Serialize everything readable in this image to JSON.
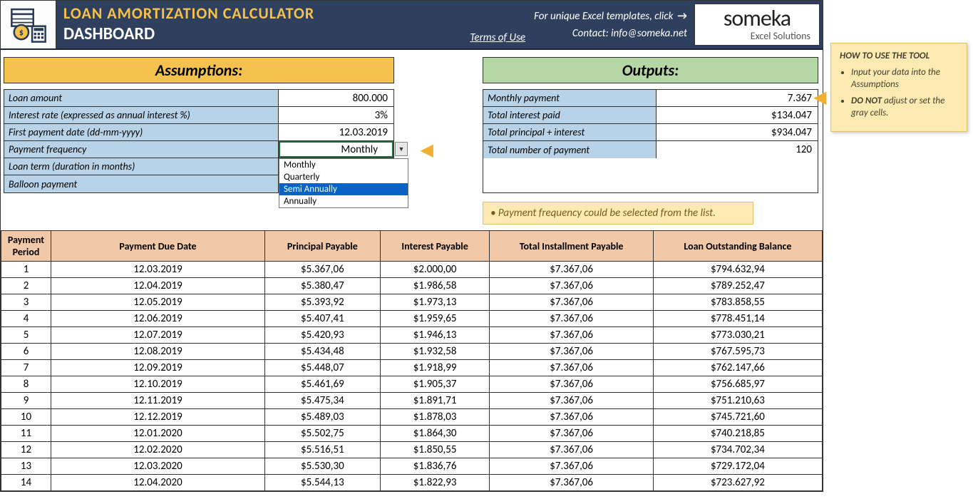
{
  "header": {
    "title": "LOAN AMORTIZATION CALCULATOR",
    "subtitle": "DASHBOARD",
    "terms": "Terms of Use",
    "click_text": "For unique Excel templates, click",
    "contact": "Contact: info@someka.net",
    "logo_big": "someka",
    "logo_small": "Excel Solutions"
  },
  "sections": {
    "assumptions": "Assumptions:",
    "outputs": "Outputs:"
  },
  "assumptions": {
    "rows": [
      {
        "label": "Loan amount",
        "value": "800.000"
      },
      {
        "label": "Interest rate (expressed as annual interest %)",
        "value": "3%"
      },
      {
        "label": "First payment date (dd-mm-yyyy)",
        "value": "12.03.2019"
      },
      {
        "label": "Payment frequency",
        "value": "Monthly"
      },
      {
        "label": "Loan term (duration in months)",
        "value": ""
      },
      {
        "label": "Balloon payment",
        "value": ""
      }
    ],
    "dropdown": {
      "options": [
        "Monthly",
        "Quarterly",
        "Semi Annually",
        "Annually"
      ],
      "selected_index": 2
    }
  },
  "outputs": {
    "rows": [
      {
        "label": "Monthly payment",
        "value": "7.367"
      },
      {
        "label": "Total interest paid",
        "value": "$134.047"
      },
      {
        "label": "Total principal + interest",
        "value": "$934.047"
      },
      {
        "label": "Total number of payment",
        "value": "120"
      }
    ]
  },
  "note": "Payment frequency could be selected from the list.",
  "sticky": {
    "title": "HOW TO USE THE TOOL",
    "bullets": [
      "Input your data into the Assumptions",
      "<b>DO NOT</b> adjust or set the gray cells."
    ]
  },
  "schedule": {
    "headers": [
      "Payment Period",
      "Payment Due Date",
      "Principal Payable",
      "Interest Payable",
      "Total Installment Payable",
      "Loan Outstanding Balance"
    ],
    "rows": [
      [
        "1",
        "12.03.2019",
        "$5.367,06",
        "$2.000,00",
        "$7.367,06",
        "$794.632,94"
      ],
      [
        "2",
        "12.04.2019",
        "$5.380,47",
        "$1.986,58",
        "$7.367,06",
        "$789.252,47"
      ],
      [
        "3",
        "12.05.2019",
        "$5.393,92",
        "$1.973,13",
        "$7.367,06",
        "$783.858,55"
      ],
      [
        "4",
        "12.06.2019",
        "$5.407,41",
        "$1.959,65",
        "$7.367,06",
        "$778.451,14"
      ],
      [
        "5",
        "12.07.2019",
        "$5.420,93",
        "$1.946,13",
        "$7.367,06",
        "$773.030,21"
      ],
      [
        "6",
        "12.08.2019",
        "$5.434,48",
        "$1.932,58",
        "$7.367,06",
        "$767.595,73"
      ],
      [
        "7",
        "12.09.2019",
        "$5.448,07",
        "$1.918,99",
        "$7.367,06",
        "$762.147,66"
      ],
      [
        "8",
        "12.10.2019",
        "$5.461,69",
        "$1.905,37",
        "$7.367,06",
        "$756.685,97"
      ],
      [
        "9",
        "12.11.2019",
        "$5.475,34",
        "$1.891,71",
        "$7.367,06",
        "$751.210,63"
      ],
      [
        "10",
        "12.12.2019",
        "$5.489,03",
        "$1.878,03",
        "$7.367,06",
        "$745.721,60"
      ],
      [
        "11",
        "12.01.2020",
        "$5.502,75",
        "$1.864,30",
        "$7.367,06",
        "$740.218,85"
      ],
      [
        "12",
        "12.02.2020",
        "$5.516,51",
        "$1.850,55",
        "$7.367,06",
        "$734.702,34"
      ],
      [
        "13",
        "12.03.2020",
        "$5.530,30",
        "$1.836,76",
        "$7.367,06",
        "$729.172,04"
      ],
      [
        "14",
        "12.04.2020",
        "$5.544,13",
        "$1.822,93",
        "$7.367,06",
        "$723.627,92"
      ]
    ]
  }
}
